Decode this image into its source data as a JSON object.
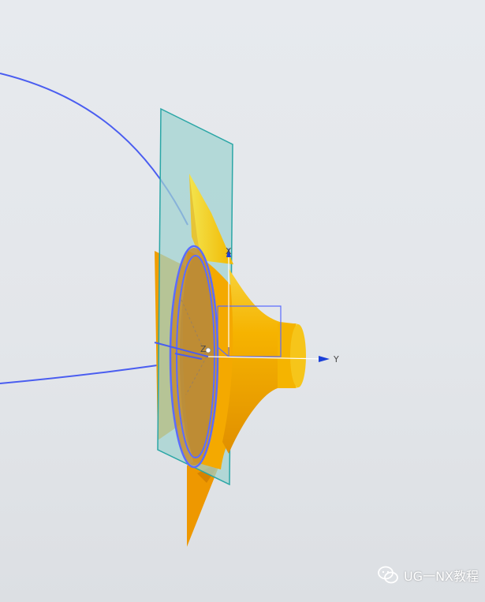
{
  "viewport": {
    "background_top": "#e7eaee",
    "background_bottom": "#dcdfe3"
  },
  "triad": {
    "x_label": "X",
    "y_label": "Y",
    "z_label": "Z"
  },
  "colors": {
    "curve_blue": "#4a5df0",
    "datum_plane_fill": "#9fd2d0",
    "datum_plane_edge": "#2aa6a6",
    "solid_orange": "#f2a500",
    "solid_yellow": "#f4e44a",
    "axis_blue": "#1a3fd8",
    "csys_blue": "#5b6cff"
  },
  "watermark": {
    "text": "UG一NX教程",
    "icon": "wechat-icon"
  }
}
